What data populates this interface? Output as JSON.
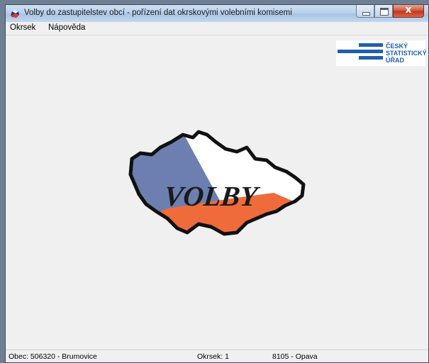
{
  "window": {
    "title": "Volby do zastupitelstev obcí - pořízení dat okrskovými volebními komisemi"
  },
  "menu": {
    "items": [
      {
        "label": "Okrsek"
      },
      {
        "label": "Nápověda"
      }
    ]
  },
  "logo": {
    "lines": [
      "ČESKÝ",
      "STATISTICKÝ",
      "ÚŘAD"
    ],
    "color": "#1f5fae"
  },
  "center_logo": {
    "text": "VOLBY",
    "colors": {
      "blue": "#6c7fb0",
      "white": "#ffffff",
      "red": "#ef6b3c"
    }
  },
  "statusbar": {
    "obec": "Obec: 506320 - Brumovice",
    "okrsek": "Okrsek: 1",
    "okres": "8105 - Opava"
  }
}
